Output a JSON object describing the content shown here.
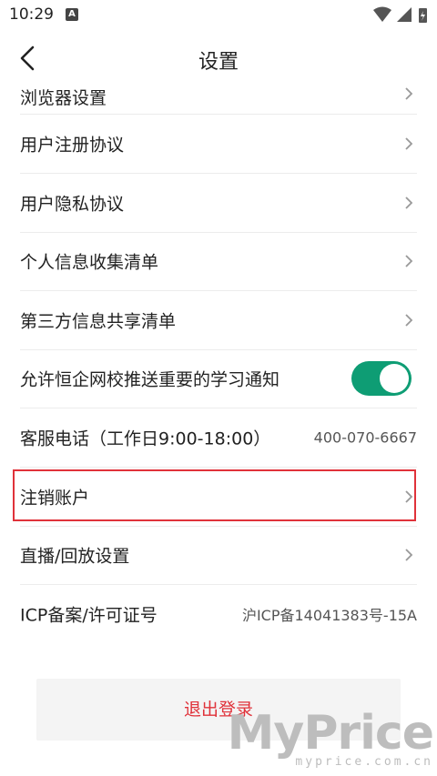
{
  "status_bar": {
    "time": "10:29",
    "notification_icon": "A"
  },
  "header": {
    "title": "设置",
    "back_icon": "chevron-left"
  },
  "items": [
    {
      "label": "浏览器设置",
      "type": "link"
    },
    {
      "label": "用户注册协议",
      "type": "link"
    },
    {
      "label": "用户隐私协议",
      "type": "link"
    },
    {
      "label": "个人信息收集清单",
      "type": "link"
    },
    {
      "label": "第三方信息共享清单",
      "type": "link"
    },
    {
      "label": "允许恒企网校推送重要的学习通知",
      "type": "toggle",
      "enabled": true
    },
    {
      "label": "客服电话（工作日9:00-18:00）",
      "type": "value",
      "value": "400-070-6667"
    },
    {
      "label": "注销账户",
      "type": "link",
      "highlighted": true
    },
    {
      "label": "直播/回放设置",
      "type": "link"
    },
    {
      "label": "ICP备案/许可证号",
      "type": "value",
      "value": "沪ICP备14041383号-15A"
    }
  ],
  "logout_label": "退出登录",
  "colors": {
    "accent_green": "#0e9d74",
    "logout_red": "#e0323a",
    "highlight_red": "#e0323a"
  },
  "watermark": {
    "main": "MyPrice",
    "sub": "myprice.com.cn"
  }
}
